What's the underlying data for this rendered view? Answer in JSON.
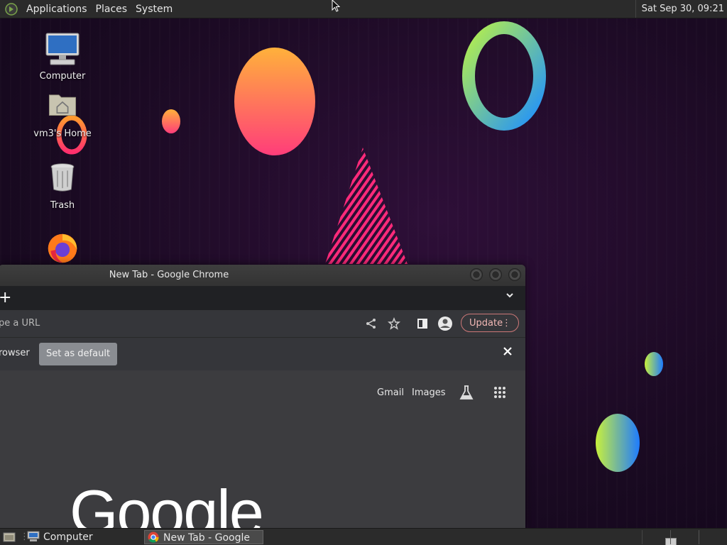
{
  "panel": {
    "menus": [
      "Applications",
      "Places",
      "System"
    ],
    "clock": "Sat Sep 30, 09:21"
  },
  "desktop": {
    "icons": [
      {
        "label": "Computer",
        "icon": "computer-icon"
      },
      {
        "label": "vm3's Home",
        "icon": "home-folder-icon"
      },
      {
        "label": "Trash",
        "icon": "trash-icon"
      },
      {
        "label": "",
        "icon": "firefox-icon"
      }
    ]
  },
  "chrome": {
    "window_title": "New Tab - Google Chrome",
    "omnibox_text": "pe a URL",
    "update_label": "Update",
    "infobar_message": "rowser",
    "set_default_label": "Set as default",
    "links": {
      "gmail": "Gmail",
      "images": "Images"
    },
    "logo_text": "Google"
  },
  "taskbar": {
    "tasks": [
      {
        "label": "Computer",
        "icon": "computer-icon",
        "active": false
      },
      {
        "label": "New Tab - Google C...",
        "icon": "chrome-icon",
        "active": true
      }
    ]
  },
  "colors": {
    "accent_update": "#f2b8b5",
    "wallpaper": "#1a0a22",
    "panel": "#2b2b2b"
  }
}
